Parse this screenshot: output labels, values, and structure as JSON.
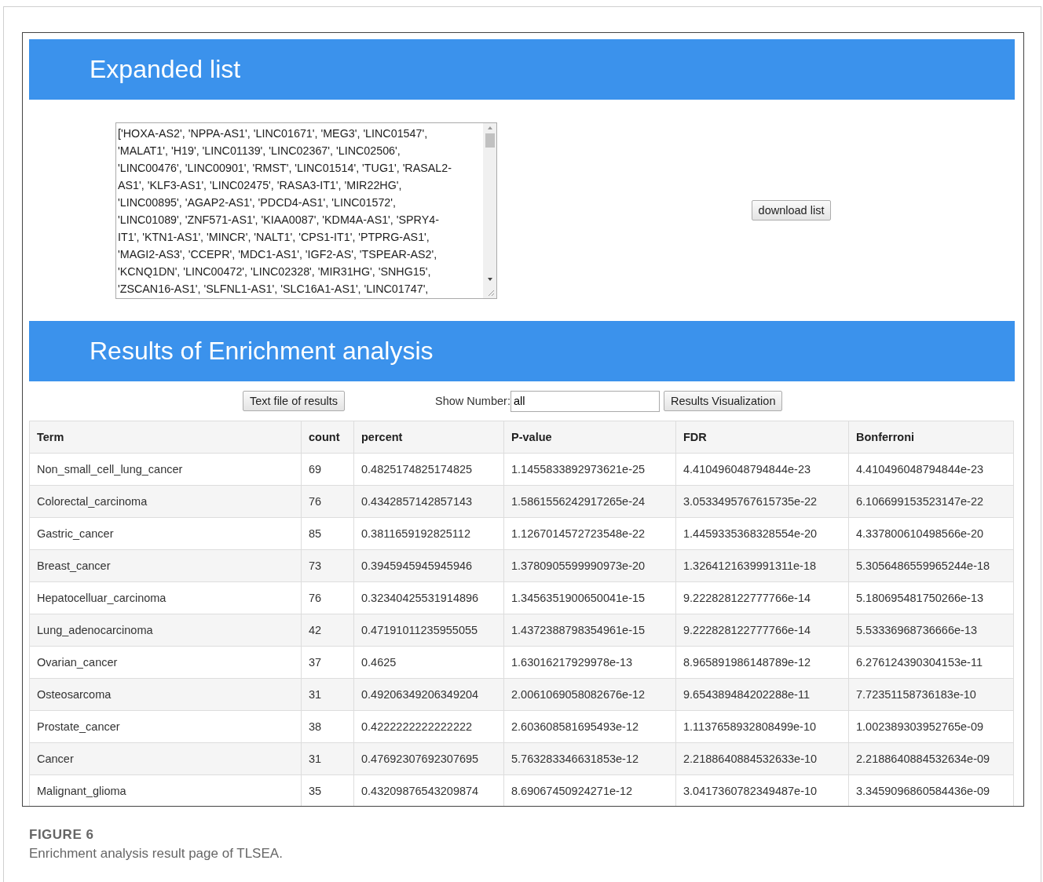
{
  "expanded_section": {
    "title": "Expanded list",
    "list_lines": [
      "['HOXA-AS2', 'NPPA-AS1', 'LINC01671', 'MEG3', 'LINC01547',",
      "'MALAT1', 'H19', 'LINC01139', 'LINC02367', 'LINC02506',",
      "'LINC00476', 'LINC00901', 'RMST', 'LINC01514', 'TUG1', 'RASAL2-",
      "AS1', 'KLF3-AS1', 'LINC02475', 'RASA3-IT1', 'MIR22HG',",
      "'LINC00895', 'AGAP2-AS1', 'PDCD4-AS1', 'LINC01572',",
      "'LINC01089', 'ZNF571-AS1', 'KIAA0087', 'KDM4A-AS1', 'SPRY4-",
      "IT1', 'KTN1-AS1', 'MINCR', 'NALT1', 'CPS1-IT1', 'PTPRG-AS1',",
      "'MAGI2-AS3', 'CCEPR', 'MDC1-AS1', 'IGF2-AS', 'TSPEAR-AS2',",
      "'KCNQ1DN', 'LINC00472', 'LINC02328', 'MIR31HG', 'SNHG15',",
      "'ZSCAN16-AS1', 'SLFNL1-AS1', 'SLC16A1-AS1', 'LINC01747',"
    ],
    "download_button": "download list"
  },
  "results_section": {
    "title": "Results of Enrichment analysis",
    "text_file_button": "Text file of results",
    "show_number_label": "Show Number:",
    "show_number_value": "all",
    "visualization_button": "Results Visualization",
    "table": {
      "columns": [
        "Term",
        "count",
        "percent",
        "P-value",
        "FDR",
        "Bonferroni"
      ],
      "rows": [
        [
          "Non_small_cell_lung_cancer",
          "69",
          "0.4825174825174825",
          "1.1455833892973621e-25",
          "4.410496048794844e-23",
          "4.410496048794844e-23"
        ],
        [
          "Colorectal_carcinoma",
          "76",
          "0.4342857142857143",
          "1.5861556242917265e-24",
          "3.0533495767615735e-22",
          "6.106699153523147e-22"
        ],
        [
          "Gastric_cancer",
          "85",
          "0.3811659192825112",
          "1.1267014572723548e-22",
          "1.4459335368328554e-20",
          "4.337800610498566e-20"
        ],
        [
          "Breast_cancer",
          "73",
          "0.3945945945945946",
          "1.3780905599990973e-20",
          "1.3264121639991311e-18",
          "5.3056486559965244e-18"
        ],
        [
          "Hepatocelluar_carcinoma",
          "76",
          "0.32340425531914896",
          "1.3456351900650041e-15",
          "9.222828122777766e-14",
          "5.180695481750266e-13"
        ],
        [
          "Lung_adenocarcinoma",
          "42",
          "0.47191011235955055",
          "1.4372388798354961e-15",
          "9.222828122777766e-14",
          "5.53336968736666e-13"
        ],
        [
          "Ovarian_cancer",
          "37",
          "0.4625",
          "1.63016217929978e-13",
          "8.965891986148789e-12",
          "6.276124390304153e-11"
        ],
        [
          "Osteosarcoma",
          "31",
          "0.49206349206349204",
          "2.0061069058082676e-12",
          "9.654389484202288e-11",
          "7.72351158736183e-10"
        ],
        [
          "Prostate_cancer",
          "38",
          "0.4222222222222222",
          "2.603608581695493e-12",
          "1.1137658932808499e-10",
          "1.002389303952765e-09"
        ],
        [
          "Cancer",
          "31",
          "0.47692307692307695",
          "5.763283346631853e-12",
          "2.2188640884532633e-10",
          "2.2188640884532634e-09"
        ],
        [
          "Malignant_glioma",
          "35",
          "0.43209876543209874",
          "8.69067450924271e-12",
          "3.0417360782349487e-10",
          "3.3459096860584436e-09"
        ]
      ]
    }
  },
  "caption": {
    "label": "FIGURE 6",
    "text": "Enrichment analysis result page of TLSEA."
  }
}
